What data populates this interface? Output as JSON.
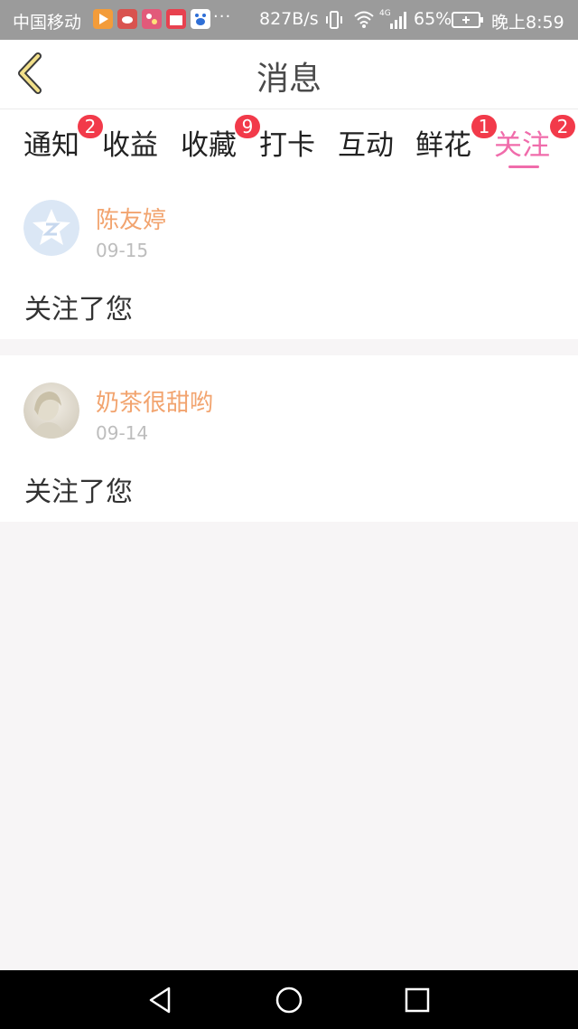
{
  "status_bar": {
    "carrier": "中国移动",
    "more": "···",
    "net_speed": "827B/s",
    "network_type": "4G",
    "battery_percent": "65%",
    "time": "晚上8:59"
  },
  "header": {
    "title": "消息"
  },
  "tabs": [
    {
      "label": "通知",
      "badge": "2"
    },
    {
      "label": "收益",
      "badge": ""
    },
    {
      "label": "收藏",
      "badge": "9"
    },
    {
      "label": "打卡",
      "badge": ""
    },
    {
      "label": "互动",
      "badge": ""
    },
    {
      "label": "鲜花",
      "badge": "1"
    },
    {
      "label": "关注",
      "badge": "2"
    }
  ],
  "active_tab": "关注",
  "messages": [
    {
      "name": "陈友婷",
      "date": "09-15",
      "text": "关注了您",
      "avatar": "default-avatar-icon"
    },
    {
      "name": "奶茶很甜哟",
      "date": "09-14",
      "text": "关注了您",
      "avatar": "user-photo"
    }
  ],
  "colors": {
    "accent": "#f06cab",
    "badge": "#f23a4a",
    "username": "#f2a46f",
    "status_bar": "#9b9b9b",
    "background": "#f7f5f6"
  }
}
